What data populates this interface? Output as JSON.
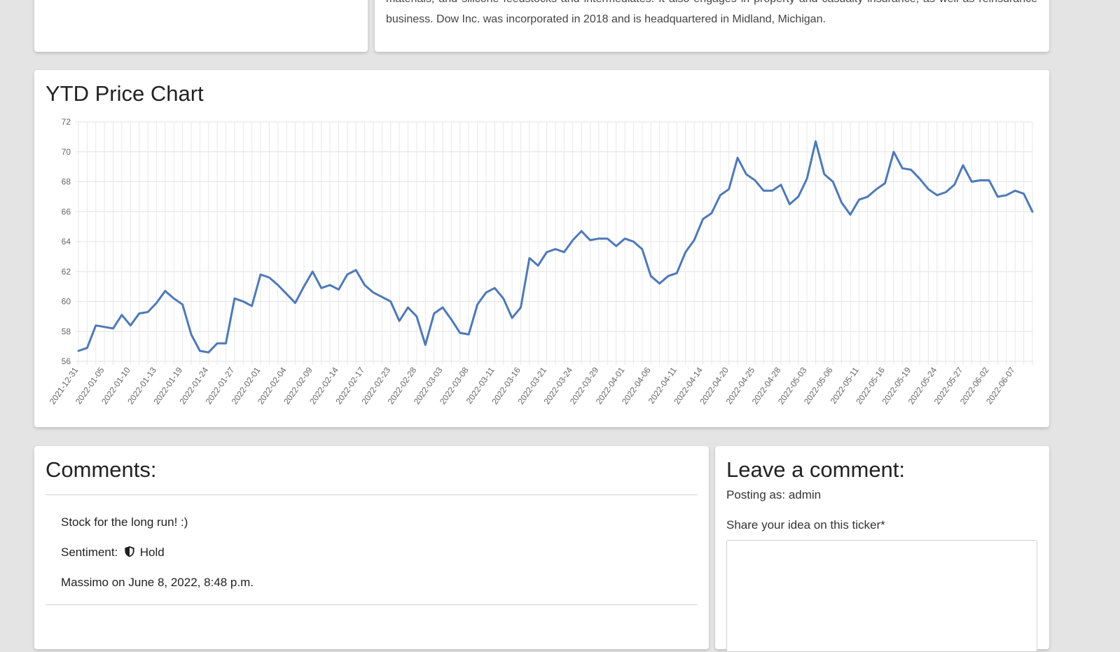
{
  "company": {
    "description_partial": "materials, and silicone feedstocks and intermediates. It also engages in property and casualty insurance, as well as reinsurance business. Dow Inc. was incorporated in 2018 and is headquartered in Midland, Michigan."
  },
  "chart_section": {
    "title": "YTD Price Chart"
  },
  "chart_data": {
    "type": "line",
    "title": "YTD Price Chart",
    "xlabel": "",
    "ylabel": "",
    "ylim": [
      56,
      72
    ],
    "yticks": [
      56,
      58,
      60,
      62,
      64,
      66,
      68,
      70,
      72
    ],
    "grid": true,
    "line_color": "#4e79b8",
    "x_tick_labels": [
      "2021-12-31",
      "2022-01-05",
      "2022-01-10",
      "2022-01-13",
      "2022-01-19",
      "2022-01-24",
      "2022-01-27",
      "2022-02-01",
      "2022-02-04",
      "2022-02-09",
      "2022-02-14",
      "2022-02-17",
      "2022-02-23",
      "2022-02-28",
      "2022-03-03",
      "2022-03-08",
      "2022-03-11",
      "2022-03-16",
      "2022-03-21",
      "2022-03-24",
      "2022-03-29",
      "2022-04-01",
      "2022-04-06",
      "2022-04-11",
      "2022-04-14",
      "2022-04-20",
      "2022-04-25",
      "2022-04-28",
      "2022-05-03",
      "2022-05-06",
      "2022-05-11",
      "2022-05-16",
      "2022-05-19",
      "2022-05-24",
      "2022-05-27",
      "2022-06-02",
      "2022-06-07"
    ],
    "values": [
      56.7,
      56.9,
      58.4,
      58.3,
      58.2,
      59.1,
      58.4,
      59.2,
      59.3,
      59.9,
      60.7,
      60.2,
      59.8,
      57.8,
      56.7,
      56.6,
      57.2,
      57.2,
      60.2,
      60.0,
      59.7,
      61.8,
      61.6,
      61.1,
      60.5,
      59.9,
      61.0,
      62.0,
      60.9,
      61.1,
      60.8,
      61.8,
      62.1,
      61.1,
      60.6,
      60.3,
      60.0,
      58.7,
      59.6,
      59.0,
      57.1,
      59.2,
      59.6,
      58.8,
      57.9,
      57.8,
      59.8,
      60.6,
      60.9,
      60.2,
      58.9,
      59.6,
      62.9,
      62.4,
      63.3,
      63.5,
      63.3,
      64.1,
      64.7,
      64.1,
      64.2,
      64.2,
      63.7,
      64.2,
      64.0,
      63.5,
      61.7,
      61.2,
      61.7,
      61.9,
      63.3,
      64.1,
      65.5,
      65.9,
      67.1,
      67.5,
      69.6,
      68.5,
      68.1,
      67.4,
      67.4,
      67.8,
      66.5,
      67.0,
      68.2,
      70.7,
      68.5,
      68.0,
      66.6,
      65.8,
      66.8,
      67.0,
      67.5,
      67.9,
      70.0,
      68.9,
      68.8,
      68.2,
      67.5,
      67.1,
      67.3,
      67.8,
      69.1,
      68.0,
      68.1,
      68.1,
      67.0,
      67.1,
      67.4,
      67.2,
      66.0
    ]
  },
  "comments_section": {
    "title": "Comments:",
    "comments": [
      {
        "text": "Stock for the long run! :)",
        "sentiment_label": "Sentiment:",
        "sentiment_icon": "shield-icon",
        "sentiment_value": "Hold",
        "author_line": "Massimo on June 8, 2022, 8:48 p.m."
      }
    ]
  },
  "comment_form": {
    "title": "Leave a comment:",
    "posting_as": "Posting as: admin",
    "field_label": "Share your idea on this ticker*",
    "field_value": ""
  }
}
